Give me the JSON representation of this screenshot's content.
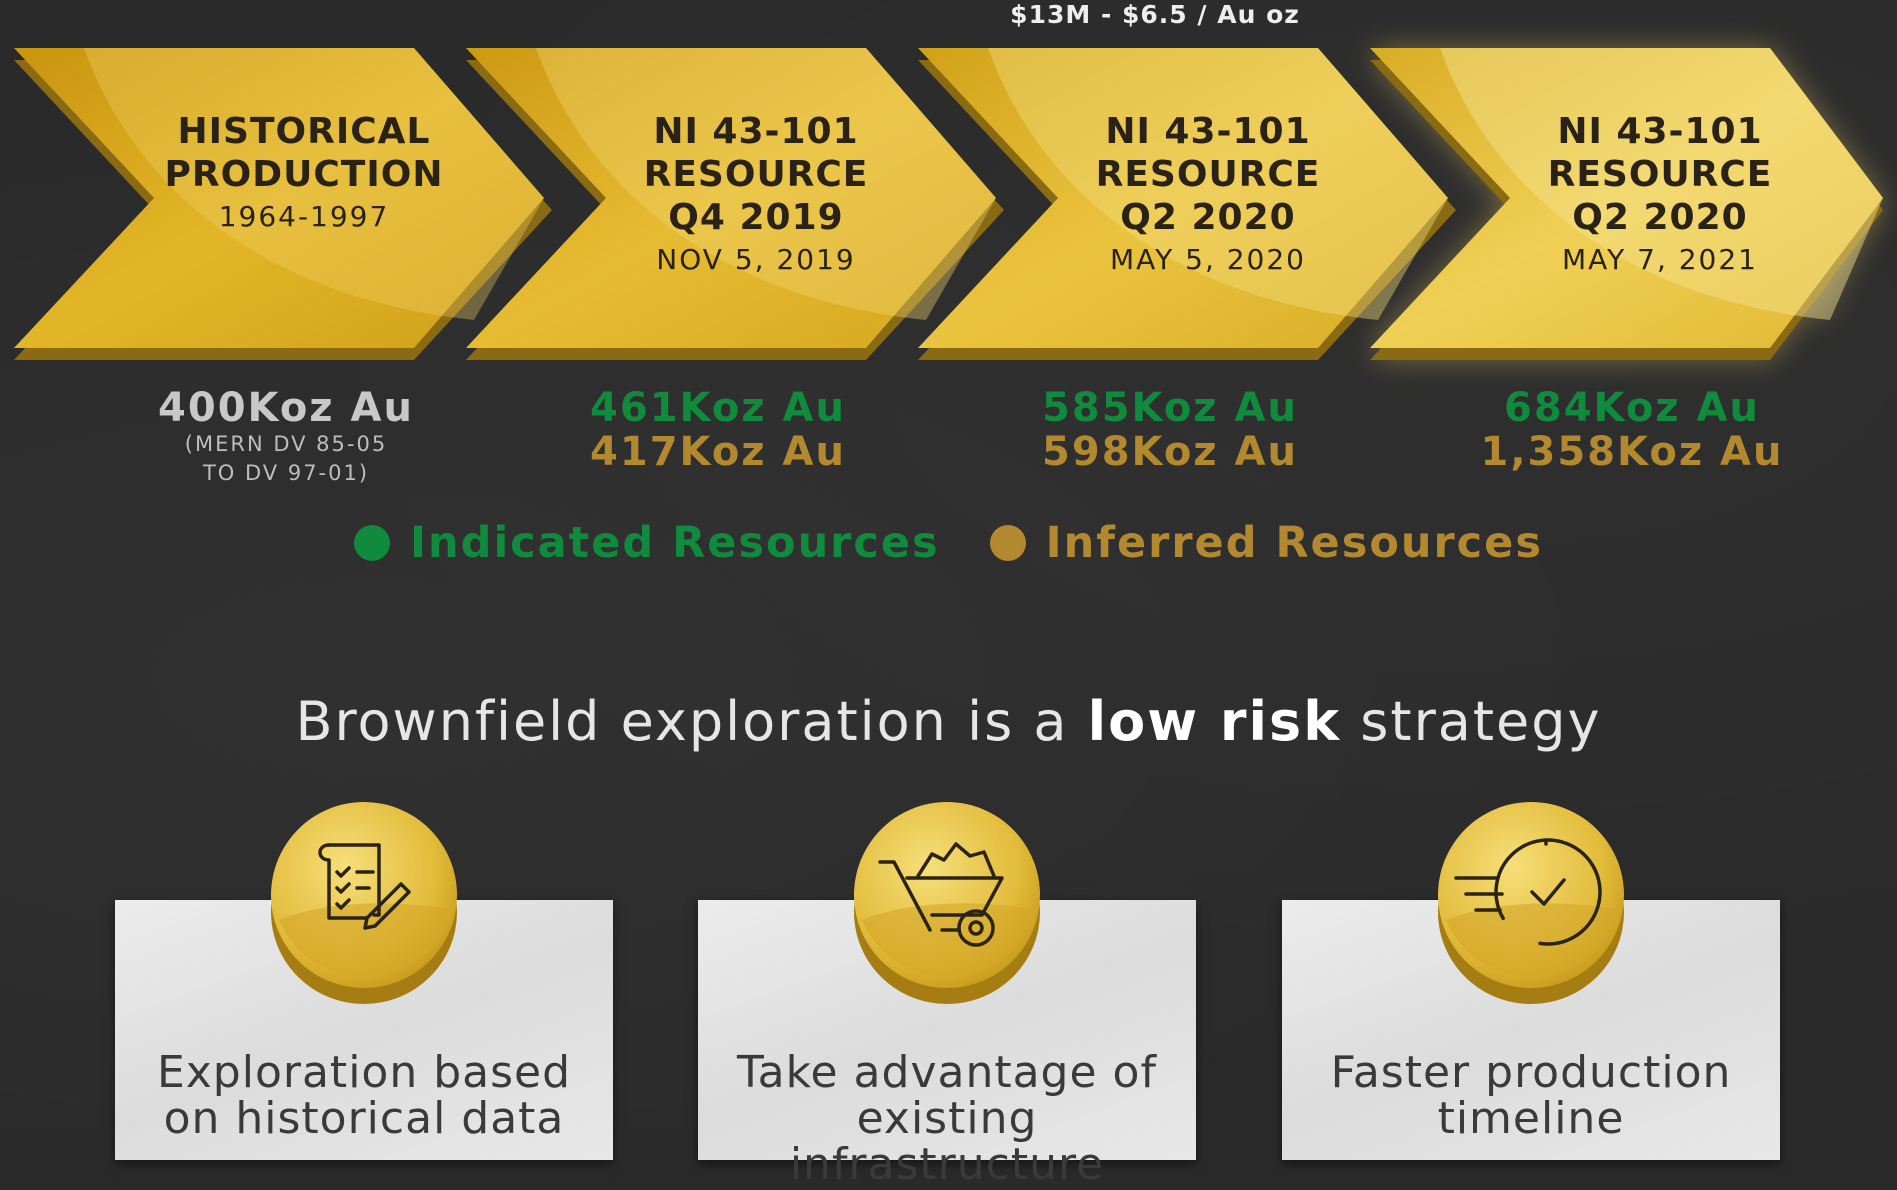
{
  "top_note": "$13M - $6.5 / Au oz",
  "timeline": [
    {
      "title": "HISTORICAL\nPRODUCTION",
      "date": "1964-1997"
    },
    {
      "title": "NI 43-101\nRESOURCE\nQ4 2019",
      "date": "NOV 5, 2019"
    },
    {
      "title": "NI 43-101\nRESOURCE\nQ2 2020",
      "date": "MAY 5, 2020"
    },
    {
      "title": "NI 43-101\nRESOURCE\nQ2 2020",
      "date": "MAY 7, 2021"
    }
  ],
  "amounts": [
    {
      "main": "400Koz Au",
      "note_1": "(MERN DV 85-05",
      "note_2": "TO DV 97-01)"
    },
    {
      "indicated": "461Koz Au",
      "inferred": "417Koz Au"
    },
    {
      "indicated": "585Koz Au",
      "inferred": "598Koz Au"
    },
    {
      "indicated": "684Koz Au",
      "inferred": "1,358Koz Au"
    }
  ],
  "legend": {
    "indicated": "Indicated Resources",
    "inferred": "Inferred Resources",
    "indicated_color": "#108a3c",
    "inferred_color": "#b3892f"
  },
  "headline": {
    "before": "Brownfield exploration is a ",
    "emphasis": "low risk",
    "after": " strategy"
  },
  "cards": [
    {
      "icon": "checklist-icon",
      "line_1": "Exploration based",
      "line_2": "on historical data"
    },
    {
      "icon": "wheelbarrow-icon",
      "line_1": "Take advantage of",
      "line_2": "existing infrastructure"
    },
    {
      "icon": "fast-clock-icon",
      "line_1": "Faster production",
      "line_2": "timeline"
    }
  ]
}
